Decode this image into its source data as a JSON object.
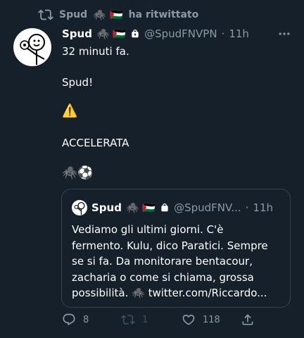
{
  "retweet": {
    "label": "Spud",
    "flags": "🕷️ 🇵🇸",
    "suffix": "ha ritwittato"
  },
  "tweet": {
    "author_name": "Spud",
    "author_emojis": "🕷️ 🇵🇸",
    "handle": "@SpudFNVPN",
    "time": "11h",
    "separator": "·",
    "lines": [
      "32 minuti fa.",
      "Spud!",
      "⚠️",
      "ACCELERATA",
      "🕷️⚽"
    ],
    "more_icon": "more-icon"
  },
  "quote": {
    "author_name": "Spud",
    "author_emojis": "🕷️ 🇵🇸",
    "handle": "@SpudFNV...",
    "separator": "·",
    "time": "11h",
    "lines": [
      "Vediamo gli ultimi giorni. C'è",
      "fermento. Kulu, dico Paratici. Sempre",
      "se si fa. Da monitorare bentacour,",
      "zacharia o come si chiama, grossa",
      "possibilità. 🕷️ twitter.com/Riccardo..."
    ]
  },
  "actions": {
    "reply_count": "8",
    "retweet_count": "1",
    "like_count": "118"
  },
  "colors": {
    "background": "#15202b",
    "muted": "#8b98a5",
    "border": "#38444d",
    "retweet_green": "#8b98a5"
  }
}
